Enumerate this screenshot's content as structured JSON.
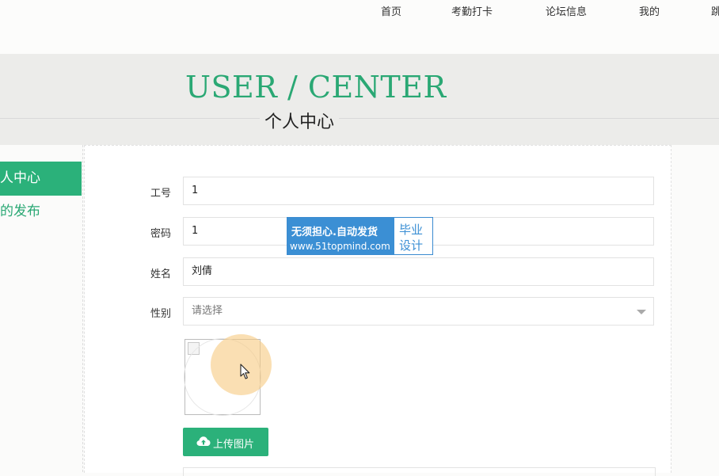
{
  "nav": {
    "items": [
      "首页",
      "考勤打卡",
      "论坛信息",
      "我的",
      "跳"
    ]
  },
  "banner": {
    "title": "USER / CENTER",
    "subtitle": "个人中心"
  },
  "sidebar": {
    "items": [
      {
        "label": "个人中心",
        "active": true
      },
      {
        "label": "我的发布",
        "active": false
      }
    ]
  },
  "form": {
    "fields": [
      {
        "label": "工号",
        "value": "1"
      },
      {
        "label": "密码",
        "value": "1"
      },
      {
        "label": "姓名",
        "value": "刘倩"
      },
      {
        "label": "性别",
        "value": "请选择"
      }
    ],
    "upload_label": "上传图片"
  },
  "watermark": {
    "line1": "无须担心.自动发货",
    "line2": "www.51topmind.com",
    "right1": "毕业",
    "right2": "设计"
  },
  "colors": {
    "accent": "#2bb17a",
    "title_green": "#2aa874",
    "banner_bg": "#ececea",
    "watermark_blue": "#3b8fd4"
  }
}
